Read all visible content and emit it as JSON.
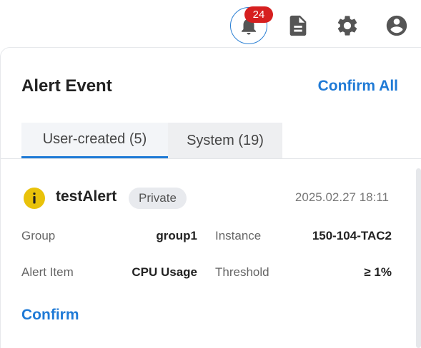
{
  "header": {
    "notification_count": "24",
    "icons": [
      "bell-icon",
      "document-icon",
      "gear-icon",
      "user-icon"
    ]
  },
  "panel": {
    "title": "Alert Event",
    "confirm_all_label": "Confirm All",
    "tabs": [
      {
        "label": "User-created (5)",
        "active": true
      },
      {
        "label": "System (19)",
        "active": false
      }
    ]
  },
  "alert": {
    "name": "testAlert",
    "visibility": "Private",
    "time": "2025.02.27 18:11",
    "group_label": "Group",
    "group_value": "group1",
    "instance_label": "Instance",
    "instance_value": "150-104-TAC2",
    "item_label": "Alert Item",
    "item_value": "CPU Usage",
    "threshold_label": "Threshold",
    "threshold_value": "≥ 1%",
    "confirm_label": "Confirm"
  },
  "colors": {
    "accent": "#1f7ad6",
    "badge": "#d61f1f",
    "info": "#e9c20a",
    "icon_gray": "#555555"
  }
}
